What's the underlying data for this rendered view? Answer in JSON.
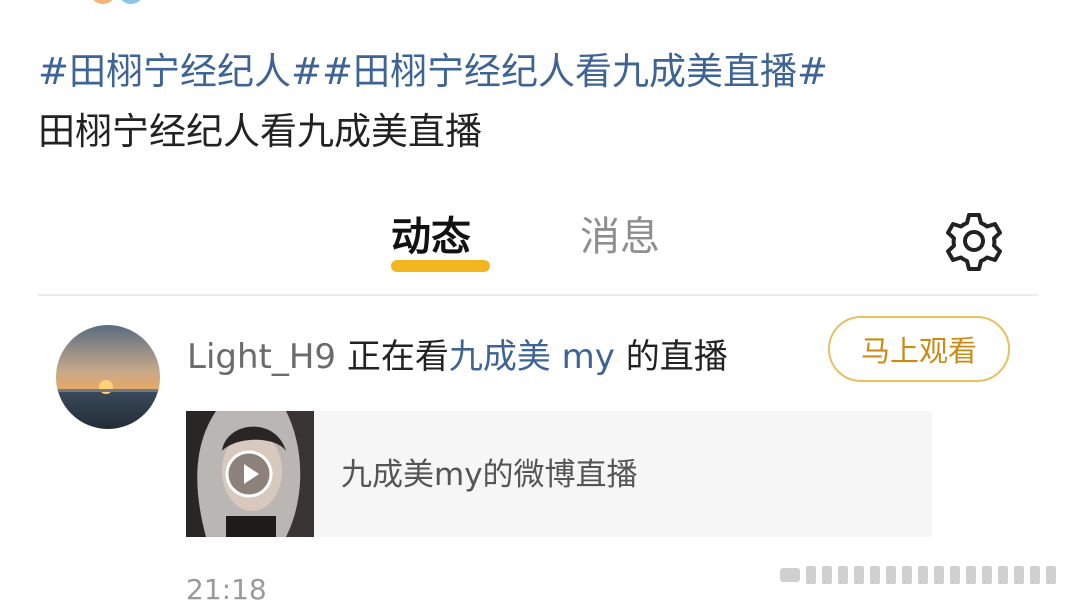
{
  "post": {
    "line1": [
      {
        "text": "#田栩宁经纪人##田栩宁经纪人看九成美直播#",
        "kind": "tag"
      }
    ],
    "line2": [
      {
        "text": "田栩宁经纪人看九成美直播",
        "kind": "plain"
      }
    ]
  },
  "tabs": {
    "active_label": "动态",
    "inactive_label": "消息"
  },
  "notification": {
    "username": "Light_H9",
    "verb": " 正在看",
    "host": "九成美 my",
    "suffix": " 的直播",
    "watch_button": "马上观看",
    "card_title": "九成美my的微博直播",
    "timestamp": "21:18"
  },
  "colors": {
    "tag_blue": "#3d6495",
    "accent_yellow": "#f3b623",
    "button_gold": "#c98b14"
  }
}
